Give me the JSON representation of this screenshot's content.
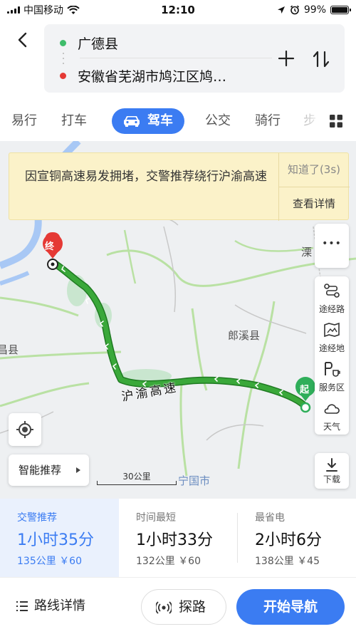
{
  "status_bar": {
    "carrier": "中国移动",
    "time": "12:10",
    "battery": "99%",
    "battery_level": 0.99
  },
  "route": {
    "from": "广德县",
    "to": "安徽省芜湖市鸠江区鸠…"
  },
  "tabs": [
    {
      "label": "易行"
    },
    {
      "label": "打车"
    },
    {
      "label": "驾车"
    },
    {
      "label": "公交"
    },
    {
      "label": "骑行"
    },
    {
      "label": "步"
    }
  ],
  "active_tab": "驾车",
  "traffic_tip": {
    "message": "因宣铜高速易发拥堵，交警推荐绕行沪渝高速",
    "dismiss": "知道了(3s)",
    "detail": "查看详情"
  },
  "map": {
    "labels": {
      "county": "郎溪县",
      "highway": "沪渝高速",
      "city": "宁国市",
      "edge_left": "昌县",
      "edge_right": "溧"
    },
    "markers": {
      "start": "起",
      "end": "终"
    },
    "scale": "30公里",
    "colors": {
      "route": "#3aa83a",
      "route_stroke": "#1f7a22",
      "start": "#2fae5a",
      "end": "#e53935"
    }
  },
  "side_tools": [
    {
      "name": "waypoint-route",
      "label": "途经路"
    },
    {
      "name": "waypoint-place",
      "label": "途经地"
    },
    {
      "name": "service-area",
      "label": "服务区"
    },
    {
      "name": "weather",
      "label": "天气"
    }
  ],
  "more_label": "•••",
  "download_label": "下载",
  "smart_recommend": "智能推荐",
  "plans": [
    {
      "tag": "交警推荐",
      "duration": "1小时35分",
      "distance": "135公里",
      "cost": "￥60"
    },
    {
      "tag": "时间最短",
      "duration": "1小时33分",
      "distance": "132公里",
      "cost": "￥60"
    },
    {
      "tag": "最省电",
      "duration": "2小时6分",
      "distance": "138公里",
      "cost": "￥45"
    }
  ],
  "bottom": {
    "details": "路线详情",
    "explore": "探路",
    "start_nav": "开始导航"
  },
  "accent_color": "#3b7cf2"
}
